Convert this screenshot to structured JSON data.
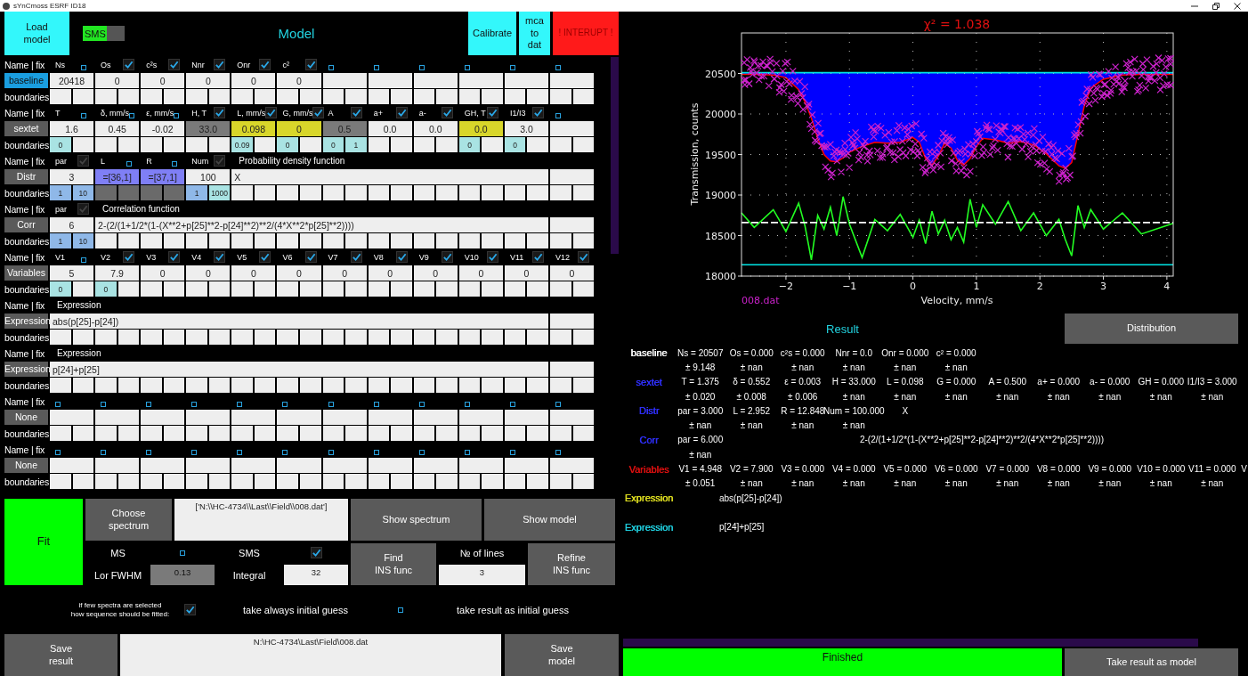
{
  "window": {
    "title": "sYnCmoss ESRF ID18"
  },
  "model": {
    "load_button": "Load\nmodel",
    "sms_toggle": {
      "label": "SMS",
      "on": true
    },
    "title": "Model",
    "calibrate_button": "Calibrate",
    "mca_button": "mca\nto\ndat",
    "interrupt_button": "! INTERUPT !",
    "blocks": [
      {
        "name": "baseline",
        "selected": true,
        "header_label": "Name | fix",
        "bounds_label": "boundaries",
        "header": [
          {
            "kind": "check",
            "label": "Ns",
            "fixed": false
          },
          {
            "kind": "check",
            "label": "Os",
            "fixed": true
          },
          {
            "kind": "check",
            "label": "c²s",
            "fixed": true
          },
          {
            "kind": "check",
            "label": "Nnr",
            "fixed": true
          },
          {
            "kind": "check",
            "label": "Onr",
            "fixed": true
          },
          {
            "kind": "check",
            "label": "c²",
            "fixed": true
          },
          {
            "kind": "check",
            "fixed": false
          },
          {
            "kind": "check",
            "fixed": false
          },
          {
            "kind": "check",
            "fixed": false
          },
          {
            "kind": "check",
            "fixed": false
          },
          {
            "kind": "check",
            "fixed": false
          },
          {
            "kind": "check",
            "fixed": false
          }
        ],
        "cells": [
          {
            "kind": "value",
            "text": "20418"
          },
          {
            "kind": "value",
            "text": "0"
          },
          {
            "kind": "value",
            "text": "0"
          },
          {
            "kind": "value",
            "text": "0"
          },
          {
            "kind": "value",
            "text": "0"
          },
          {
            "kind": "value",
            "text": "0"
          },
          {
            "kind": "blank"
          },
          {
            "kind": "blank"
          },
          {
            "kind": "blank"
          },
          {
            "kind": "blank"
          },
          {
            "kind": "blank"
          },
          {
            "kind": "blank"
          }
        ],
        "bounds": [
          {
            "kind": "blank"
          },
          {
            "kind": "blank"
          },
          {
            "kind": "blank"
          },
          {
            "kind": "blank"
          },
          {
            "kind": "blank"
          },
          {
            "kind": "blank"
          },
          {
            "kind": "blank"
          },
          {
            "kind": "blank"
          },
          {
            "kind": "blank"
          },
          {
            "kind": "blank"
          },
          {
            "kind": "blank"
          },
          {
            "kind": "blank"
          },
          {
            "kind": "blank"
          },
          {
            "kind": "blank"
          },
          {
            "kind": "blank"
          },
          {
            "kind": "blank"
          },
          {
            "kind": "blank"
          },
          {
            "kind": "blank"
          },
          {
            "kind": "blank"
          },
          {
            "kind": "blank"
          },
          {
            "kind": "blank"
          },
          {
            "kind": "blank"
          },
          {
            "kind": "blank"
          },
          {
            "kind": "blank"
          }
        ]
      },
      {
        "name": "sextet",
        "selected": false,
        "header_label": "Name | fix",
        "bounds_label": "boundaries",
        "header": [
          {
            "kind": "check",
            "label": "T",
            "fixed": false
          },
          {
            "kind": "check",
            "label": "δ, mm/s",
            "fixed": false
          },
          {
            "kind": "check",
            "label": "ε, mm/s",
            "fixed": false
          },
          {
            "kind": "check",
            "label": "H, T",
            "fixed": true
          },
          {
            "kind": "check",
            "label": "L, mm/s",
            "fixed": true
          },
          {
            "kind": "check",
            "label": "G, mm/s",
            "fixed": true
          },
          {
            "kind": "check",
            "label": "A",
            "fixed": true
          },
          {
            "kind": "check",
            "label": "a+",
            "fixed": true
          },
          {
            "kind": "check",
            "label": "a-",
            "fixed": true
          },
          {
            "kind": "check",
            "label": "GH, T",
            "fixed": true
          },
          {
            "kind": "check",
            "label": "I1/I3",
            "fixed": true
          },
          {
            "kind": "check",
            "fixed": false
          }
        ],
        "cells": [
          {
            "kind": "value",
            "text": "1.6"
          },
          {
            "kind": "value",
            "text": "0.45"
          },
          {
            "kind": "value",
            "text": "-0.02"
          },
          {
            "kind": "value",
            "text": "33.0",
            "color": "#7a7a7a"
          },
          {
            "kind": "value",
            "text": "0.098",
            "color": "#d8d62a"
          },
          {
            "kind": "value",
            "text": "0",
            "color": "#d8d62a"
          },
          {
            "kind": "value",
            "text": "0.5",
            "color": "#7a7a7a"
          },
          {
            "kind": "value",
            "text": "0.0"
          },
          {
            "kind": "value",
            "text": "0.0"
          },
          {
            "kind": "value",
            "text": "0.0",
            "color": "#d8d62a"
          },
          {
            "kind": "value",
            "text": "3.0"
          },
          {
            "kind": "blank"
          }
        ],
        "bounds": [
          {
            "kind": "value",
            "text": "0",
            "color": "#a9e3e3"
          },
          {
            "kind": "blank"
          },
          {
            "kind": "blank"
          },
          {
            "kind": "blank"
          },
          {
            "kind": "blank"
          },
          {
            "kind": "blank"
          },
          {
            "kind": "blank"
          },
          {
            "kind": "blank"
          },
          {
            "kind": "value",
            "text": "0.09",
            "color": "#a9e3e3"
          },
          {
            "kind": "blank"
          },
          {
            "kind": "value",
            "text": "0",
            "color": "#a9e3e3"
          },
          {
            "kind": "blank"
          },
          {
            "kind": "value",
            "text": "0",
            "color": "#a9e3e3"
          },
          {
            "kind": "value",
            "text": "1",
            "color": "#a9e3e3"
          },
          {
            "kind": "blank"
          },
          {
            "kind": "blank"
          },
          {
            "kind": "blank"
          },
          {
            "kind": "blank"
          },
          {
            "kind": "value",
            "text": "0",
            "color": "#a9e3e3"
          },
          {
            "kind": "blank"
          },
          {
            "kind": "value",
            "text": "0",
            "color": "#a9e3e3"
          },
          {
            "kind": "blank"
          },
          {
            "kind": "blank"
          },
          {
            "kind": "blank"
          }
        ]
      },
      {
        "name": "Distr",
        "selected": false,
        "header_label": "Name | fix",
        "bounds_label": "boundaries",
        "header": [
          {
            "kind": "check",
            "label": "par",
            "fixed": true,
            "disabled": true
          },
          {
            "kind": "check",
            "label": "L",
            "fixed": false,
            "disabled": false
          },
          {
            "kind": "check",
            "label": "R",
            "fixed": false,
            "disabled": false
          },
          {
            "kind": "check",
            "label": "Num",
            "fixed": true,
            "disabled": true
          },
          {
            "kind": "caption",
            "label": "Probability density function"
          }
        ],
        "cells": [
          {
            "kind": "value",
            "text": "3"
          },
          {
            "kind": "value",
            "text": "=[36,1]",
            "color": "#7f7ff5"
          },
          {
            "kind": "value",
            "text": "=[37,1]",
            "color": "#7f7ff5"
          },
          {
            "kind": "value",
            "text": "100"
          },
          {
            "kind": "formula",
            "text": "X"
          },
          {
            "kind": "blank"
          }
        ],
        "bounds": [
          {
            "kind": "value",
            "text": "1",
            "color": "#8fb8e8"
          },
          {
            "kind": "value",
            "text": "10",
            "color": "#8fb8e8"
          },
          {
            "kind": "blank",
            "color": "#6a6a6a"
          },
          {
            "kind": "blank",
            "color": "#6a6a6a"
          },
          {
            "kind": "blank",
            "color": "#6a6a6a"
          },
          {
            "kind": "blank",
            "color": "#6a6a6a"
          },
          {
            "kind": "value",
            "text": "1",
            "color": "#8fb8e8"
          },
          {
            "kind": "value",
            "text": "1000",
            "color": "#a9e3e3"
          },
          {
            "kind": "blank"
          },
          {
            "kind": "blank"
          },
          {
            "kind": "blank"
          },
          {
            "kind": "blank"
          },
          {
            "kind": "blank"
          },
          {
            "kind": "blank"
          },
          {
            "kind": "blank"
          },
          {
            "kind": "blank"
          },
          {
            "kind": "blank"
          },
          {
            "kind": "blank"
          },
          {
            "kind": "blank"
          },
          {
            "kind": "blank"
          },
          {
            "kind": "blank"
          },
          {
            "kind": "blank"
          },
          {
            "kind": "blank"
          },
          {
            "kind": "blank"
          }
        ]
      },
      {
        "name": "Corr",
        "selected": false,
        "header_label": "Name | fix",
        "bounds_label": "boundaries",
        "header": [
          {
            "kind": "check",
            "label": "par",
            "fixed": true,
            "disabled": true
          },
          {
            "kind": "caption",
            "label": "Correlation function"
          }
        ],
        "cells": [
          {
            "kind": "value",
            "text": "6"
          },
          {
            "kind": "formula",
            "text": "2-(2/(1+1/2*(1-(X**2+p[25]**2-p[24]**2)**2/(4*X**2*p[25]**2))))"
          },
          {
            "kind": "blank"
          }
        ],
        "bounds": [
          {
            "kind": "value",
            "text": "1",
            "color": "#8fb8e8"
          },
          {
            "kind": "value",
            "text": "10",
            "color": "#8fb8e8"
          },
          {
            "kind": "blank"
          },
          {
            "kind": "blank"
          },
          {
            "kind": "blank"
          },
          {
            "kind": "blank"
          },
          {
            "kind": "blank"
          },
          {
            "kind": "blank"
          },
          {
            "kind": "blank"
          },
          {
            "kind": "blank"
          },
          {
            "kind": "blank"
          },
          {
            "kind": "blank"
          },
          {
            "kind": "blank"
          },
          {
            "kind": "blank"
          },
          {
            "kind": "blank"
          },
          {
            "kind": "blank"
          },
          {
            "kind": "blank"
          },
          {
            "kind": "blank"
          },
          {
            "kind": "blank"
          },
          {
            "kind": "blank"
          },
          {
            "kind": "blank"
          },
          {
            "kind": "blank"
          },
          {
            "kind": "blank"
          },
          {
            "kind": "blank"
          }
        ]
      },
      {
        "name": "Variables",
        "selected": false,
        "header_label": "Name | fix",
        "bounds_label": "boundaries",
        "header": [
          {
            "kind": "check",
            "label": "V1",
            "fixed": false
          },
          {
            "kind": "check",
            "label": "V2",
            "fixed": true
          },
          {
            "kind": "check",
            "label": "V3",
            "fixed": true
          },
          {
            "kind": "check",
            "label": "V4",
            "fixed": true
          },
          {
            "kind": "check",
            "label": "V5",
            "fixed": true
          },
          {
            "kind": "check",
            "label": "V6",
            "fixed": true
          },
          {
            "kind": "check",
            "label": "V7",
            "fixed": true
          },
          {
            "kind": "check",
            "label": "V8",
            "fixed": true
          },
          {
            "kind": "check",
            "label": "V9",
            "fixed": true
          },
          {
            "kind": "check",
            "label": "V10",
            "fixed": true
          },
          {
            "kind": "check",
            "label": "V11",
            "fixed": true
          },
          {
            "kind": "check",
            "label": "V12",
            "fixed": true
          }
        ],
        "cells": [
          {
            "kind": "value",
            "text": "5"
          },
          {
            "kind": "value",
            "text": "7.9"
          },
          {
            "kind": "value",
            "text": "0"
          },
          {
            "kind": "value",
            "text": "0"
          },
          {
            "kind": "value",
            "text": "0"
          },
          {
            "kind": "value",
            "text": "0"
          },
          {
            "kind": "value",
            "text": "0"
          },
          {
            "kind": "value",
            "text": "0"
          },
          {
            "kind": "value",
            "text": "0"
          },
          {
            "kind": "value",
            "text": "0"
          },
          {
            "kind": "value",
            "text": "0"
          },
          {
            "kind": "value",
            "text": "0"
          }
        ],
        "bounds": [
          {
            "kind": "value",
            "text": "0",
            "color": "#a9e3e3"
          },
          {
            "kind": "blank"
          },
          {
            "kind": "value",
            "text": "0",
            "color": "#a9e3e3"
          },
          {
            "kind": "blank"
          },
          {
            "kind": "blank"
          },
          {
            "kind": "blank"
          },
          {
            "kind": "blank"
          },
          {
            "kind": "blank"
          },
          {
            "kind": "blank"
          },
          {
            "kind": "blank"
          },
          {
            "kind": "blank"
          },
          {
            "kind": "blank"
          },
          {
            "kind": "blank"
          },
          {
            "kind": "blank"
          },
          {
            "kind": "blank"
          },
          {
            "kind": "blank"
          },
          {
            "kind": "blank"
          },
          {
            "kind": "blank"
          },
          {
            "kind": "blank"
          },
          {
            "kind": "blank"
          },
          {
            "kind": "blank"
          },
          {
            "kind": "blank"
          },
          {
            "kind": "blank"
          },
          {
            "kind": "blank"
          }
        ]
      },
      {
        "name": "Expression",
        "selected": false,
        "header_label": "Name | fix",
        "bounds_label": "boundaries",
        "header": [
          {
            "kind": "caption",
            "label": "Expression"
          }
        ],
        "cells": [
          {
            "kind": "formula",
            "text": "abs(p[25]-p[24])"
          },
          {
            "kind": "blank"
          }
        ],
        "bounds": [
          {
            "kind": "blank"
          },
          {
            "kind": "blank"
          },
          {
            "kind": "blank"
          },
          {
            "kind": "blank"
          },
          {
            "kind": "blank"
          },
          {
            "kind": "blank"
          },
          {
            "kind": "blank"
          },
          {
            "kind": "blank"
          },
          {
            "kind": "blank"
          },
          {
            "kind": "blank"
          },
          {
            "kind": "blank"
          },
          {
            "kind": "blank"
          },
          {
            "kind": "blank"
          },
          {
            "kind": "blank"
          },
          {
            "kind": "blank"
          },
          {
            "kind": "blank"
          },
          {
            "kind": "blank"
          },
          {
            "kind": "blank"
          },
          {
            "kind": "blank"
          },
          {
            "kind": "blank"
          },
          {
            "kind": "blank"
          },
          {
            "kind": "blank"
          },
          {
            "kind": "blank"
          },
          {
            "kind": "blank"
          }
        ]
      },
      {
        "name": "Expression",
        "selected": false,
        "header_label": "Name | fix",
        "bounds_label": "boundaries",
        "header": [
          {
            "kind": "caption",
            "label": "Expression"
          }
        ],
        "cells": [
          {
            "kind": "formula",
            "text": "p[24]+p[25]"
          },
          {
            "kind": "blank"
          }
        ],
        "bounds": [
          {
            "kind": "blank"
          },
          {
            "kind": "blank"
          },
          {
            "kind": "blank"
          },
          {
            "kind": "blank"
          },
          {
            "kind": "blank"
          },
          {
            "kind": "blank"
          },
          {
            "kind": "blank"
          },
          {
            "kind": "blank"
          },
          {
            "kind": "blank"
          },
          {
            "kind": "blank"
          },
          {
            "kind": "blank"
          },
          {
            "kind": "blank"
          },
          {
            "kind": "blank"
          },
          {
            "kind": "blank"
          },
          {
            "kind": "blank"
          },
          {
            "kind": "blank"
          },
          {
            "kind": "blank"
          },
          {
            "kind": "blank"
          },
          {
            "kind": "blank"
          },
          {
            "kind": "blank"
          },
          {
            "kind": "blank"
          },
          {
            "kind": "blank"
          },
          {
            "kind": "blank"
          },
          {
            "kind": "blank"
          }
        ]
      },
      {
        "name": "None",
        "selected": false,
        "header_label": "Name | fix",
        "bounds_label": "boundaries",
        "header": [
          {
            "kind": "check",
            "fixed": false
          },
          {
            "kind": "check",
            "fixed": false
          },
          {
            "kind": "check",
            "fixed": false
          },
          {
            "kind": "check",
            "fixed": false
          },
          {
            "kind": "check",
            "fixed": false
          },
          {
            "kind": "check",
            "fixed": false
          },
          {
            "kind": "check",
            "fixed": false
          },
          {
            "kind": "check",
            "fixed": false
          },
          {
            "kind": "check",
            "fixed": false
          },
          {
            "kind": "check",
            "fixed": false
          },
          {
            "kind": "check",
            "fixed": false
          },
          {
            "kind": "check",
            "fixed": false
          }
        ],
        "cells": [
          {
            "kind": "blank"
          },
          {
            "kind": "blank"
          },
          {
            "kind": "blank"
          },
          {
            "kind": "blank"
          },
          {
            "kind": "blank"
          },
          {
            "kind": "blank"
          },
          {
            "kind": "blank"
          },
          {
            "kind": "blank"
          },
          {
            "kind": "blank"
          },
          {
            "kind": "blank"
          },
          {
            "kind": "blank"
          },
          {
            "kind": "blank"
          }
        ],
        "bounds": [
          {
            "kind": "blank"
          },
          {
            "kind": "blank"
          },
          {
            "kind": "blank"
          },
          {
            "kind": "blank"
          },
          {
            "kind": "blank"
          },
          {
            "kind": "blank"
          },
          {
            "kind": "blank"
          },
          {
            "kind": "blank"
          },
          {
            "kind": "blank"
          },
          {
            "kind": "blank"
          },
          {
            "kind": "blank"
          },
          {
            "kind": "blank"
          },
          {
            "kind": "blank"
          },
          {
            "kind": "blank"
          },
          {
            "kind": "blank"
          },
          {
            "kind": "blank"
          },
          {
            "kind": "blank"
          },
          {
            "kind": "blank"
          },
          {
            "kind": "blank"
          },
          {
            "kind": "blank"
          },
          {
            "kind": "blank"
          },
          {
            "kind": "blank"
          },
          {
            "kind": "blank"
          },
          {
            "kind": "blank"
          }
        ]
      },
      {
        "name": "None",
        "selected": false,
        "header_label": "Name | fix",
        "bounds_label": "boundaries",
        "header": [
          {
            "kind": "check",
            "fixed": false
          },
          {
            "kind": "check",
            "fixed": false
          },
          {
            "kind": "check",
            "fixed": false
          },
          {
            "kind": "check",
            "fixed": false
          },
          {
            "kind": "check",
            "fixed": false
          },
          {
            "kind": "check",
            "fixed": false
          },
          {
            "kind": "check",
            "fixed": false
          },
          {
            "kind": "check",
            "fixed": false
          },
          {
            "kind": "check",
            "fixed": false
          },
          {
            "kind": "check",
            "fixed": false
          },
          {
            "kind": "check",
            "fixed": false
          },
          {
            "kind": "check",
            "fixed": false
          }
        ],
        "cells": [
          {
            "kind": "blank"
          },
          {
            "kind": "blank"
          },
          {
            "kind": "blank"
          },
          {
            "kind": "blank"
          },
          {
            "kind": "blank"
          },
          {
            "kind": "blank"
          },
          {
            "kind": "blank"
          },
          {
            "kind": "blank"
          },
          {
            "kind": "blank"
          },
          {
            "kind": "blank"
          },
          {
            "kind": "blank"
          },
          {
            "kind": "blank"
          }
        ],
        "bounds": [
          {
            "kind": "blank"
          },
          {
            "kind": "blank"
          },
          {
            "kind": "blank"
          },
          {
            "kind": "blank"
          },
          {
            "kind": "blank"
          },
          {
            "kind": "blank"
          },
          {
            "kind": "blank"
          },
          {
            "kind": "blank"
          },
          {
            "kind": "blank"
          },
          {
            "kind": "blank"
          },
          {
            "kind": "blank"
          },
          {
            "kind": "blank"
          },
          {
            "kind": "blank"
          },
          {
            "kind": "blank"
          },
          {
            "kind": "blank"
          },
          {
            "kind": "blank"
          },
          {
            "kind": "blank"
          },
          {
            "kind": "blank"
          },
          {
            "kind": "blank"
          },
          {
            "kind": "blank"
          },
          {
            "kind": "blank"
          },
          {
            "kind": "blank"
          },
          {
            "kind": "blank"
          },
          {
            "kind": "blank"
          }
        ]
      }
    ]
  },
  "fit_panel": {
    "fit_button": "Fit",
    "choose_button": "Choose\nspectrum",
    "files_field": "['N:\\\\HC-4734\\\\Last\\\\Field\\\\008.dat']",
    "show_spectrum_button": "Show spectrum",
    "show_model_button": "Show model",
    "ms": {
      "label": "MS",
      "checked": false
    },
    "sms": {
      "label": "SMS",
      "checked": true
    },
    "lor_fwhm": {
      "label": "Lor FWHM",
      "value": "0.13"
    },
    "integral": {
      "label": "Integral",
      "value": "32"
    },
    "find_button": "Find\nINS func",
    "lines": {
      "label": "№ of lines",
      "value": "3"
    },
    "refine_button": "Refine\nINS func",
    "sequence_note": "if few spectra are selected\nhow sequence should be fitted:",
    "sequence_options": [
      {
        "label": "take always initial guess",
        "checked": true
      },
      {
        "label": "take result as initial guess",
        "checked": false
      }
    ],
    "save_result_button": "Save\nresult",
    "path_field": "N:\\HC-4734\\Last\\Field\\008.dat",
    "save_model_button": "Save\nmodel"
  },
  "spectrum_panel": {
    "spectrum_label": "008.dat",
    "chart_data": {
      "type": "line",
      "title": "χ² = 1.038",
      "xlabel": "Velocity, mm/s",
      "ylabel": "Transmission, counts",
      "grid": true,
      "x": [
        -2.7,
        -2.5,
        -2.2,
        -2.0,
        -1.8,
        -1.7,
        -1.6,
        -1.5,
        -1.4,
        -1.3,
        -1.2,
        -1.1,
        -1.0,
        -0.8,
        -0.6,
        -0.4,
        -0.2,
        0.0,
        0.1,
        0.2,
        0.3,
        0.4,
        0.5,
        0.6,
        0.7,
        0.8,
        0.9,
        1.0,
        1.1,
        1.3,
        1.5,
        1.7,
        1.9,
        2.1,
        2.3,
        2.4,
        2.5,
        2.6,
        2.7,
        2.8,
        3.0,
        3.3,
        3.6,
        4.1
      ],
      "series": [
        {
          "color": "#ff0000",
          "values": [
            20490,
            20490,
            20480,
            20450,
            20300,
            20150,
            19950,
            19700,
            19500,
            19420,
            19410,
            19460,
            19530,
            19600,
            19650,
            19640,
            19650,
            19710,
            19650,
            19450,
            19370,
            19480,
            19640,
            19580,
            19430,
            19370,
            19450,
            19600,
            19700,
            19680,
            19640,
            19660,
            19620,
            19510,
            19360,
            19330,
            19400,
            19750,
            20100,
            20320,
            20430,
            20480,
            20490,
            20490
          ]
        },
        {
          "color": "#00e5e5",
          "values": [
            20510,
            20510,
            20510,
            20510,
            20510,
            20510,
            20510,
            20510,
            20510,
            20510,
            20510,
            20510,
            20510,
            20510,
            20510,
            20510,
            20510,
            20510,
            20510,
            20510,
            20510,
            20510,
            20510,
            20510,
            20510,
            20510,
            20510,
            20510,
            20510,
            20510,
            20510,
            20510,
            20510,
            20510,
            20510,
            20510,
            20510,
            20510,
            20510,
            20510,
            20510,
            20510,
            20510,
            20510
          ]
        },
        {
          "color": "#22ff22",
          "values": [
            18780,
            18600,
            18820,
            18550,
            18900,
            18620,
            18200,
            18750,
            18580,
            18850,
            18500,
            18980,
            18640,
            18230,
            18700,
            18560,
            18760,
            18480,
            18690,
            18400,
            18800,
            18520,
            18690,
            18450,
            18600,
            18420,
            18950,
            18600,
            18880,
            18640,
            18920,
            18560,
            18780,
            18500,
            18700,
            18450,
            18250,
            18870,
            18600,
            18820,
            18580,
            18780,
            18520,
            18650
          ]
        },
        {
          "color": "#ffffff",
          "line_style": "dashed",
          "values": [
            18660,
            18660,
            18660,
            18660,
            18660,
            18660,
            18660,
            18660,
            18660,
            18660,
            18660,
            18660,
            18660,
            18660,
            18660,
            18660,
            18660,
            18660,
            18660,
            18660,
            18660,
            18660,
            18660,
            18660,
            18660,
            18660,
            18660,
            18660,
            18660,
            18660,
            18660,
            18660,
            18660,
            18660,
            18660,
            18660,
            18660,
            18660,
            18660,
            18660,
            18660,
            18660,
            18660,
            18660
          ]
        },
        {
          "color": "#00e5e5",
          "values": [
            18140,
            18140,
            18140,
            18140,
            18140,
            18140,
            18140,
            18140,
            18140,
            18140,
            18140,
            18140,
            18140,
            18140,
            18140,
            18140,
            18140,
            18140,
            18140,
            18140,
            18140,
            18140,
            18140,
            18140,
            18140,
            18140,
            18140,
            18140,
            18140,
            18140,
            18140,
            18140,
            18140,
            18140,
            18140,
            18140,
            18140,
            18140,
            18140,
            18140,
            18140,
            18140,
            18140,
            18140
          ]
        }
      ],
      "xlim": [
        -2.7,
        4.1
      ],
      "ylim": [
        18000,
        21000
      ],
      "xticks": [
        {
          "value": -2,
          "label": "−2"
        },
        {
          "value": -1,
          "label": "−1"
        },
        0,
        1,
        2,
        3,
        4
      ],
      "yticks": [
        18000,
        18500,
        19000,
        19500,
        20000,
        20500
      ]
    }
  },
  "results": {
    "title": "Result",
    "distribution_button": "Distribution",
    "groups": [
      {
        "kind": "parameters",
        "name": "baseline",
        "color": "#ffffff",
        "items": [
          {
            "value": "Ns = 20507",
            "error": "± 9.148"
          },
          {
            "value": "Os = 0.000",
            "error": "± nan"
          },
          {
            "value": "c²s = 0.000",
            "error": "± nan"
          },
          {
            "value": "Nnr = 0.0",
            "error": "± nan"
          },
          {
            "value": "Onr = 0.000",
            "error": "± nan"
          },
          {
            "value": "c² = 0.000",
            "error": "± nan"
          }
        ]
      },
      {
        "kind": "parameters",
        "name": "sextet",
        "color": "#3030ff",
        "items": [
          {
            "value": "T = 1.375",
            "error": "± 0.020"
          },
          {
            "value": "δ = 0.552",
            "error": "± 0.008"
          },
          {
            "value": "ε = 0.003",
            "error": "± 0.006"
          },
          {
            "value": "H = 33.000",
            "error": "± nan"
          },
          {
            "value": "L = 0.098",
            "error": "± nan"
          },
          {
            "value": "G = 0.000",
            "error": "± nan"
          },
          {
            "value": "A = 0.500",
            "error": "± nan"
          },
          {
            "value": "a+ = 0.000",
            "error": "± nan"
          },
          {
            "value": "a- = 0.000",
            "error": "± nan"
          },
          {
            "value": "GH = 0.000",
            "error": "± nan"
          },
          {
            "value": "I1/I3 = 3.000",
            "error": "± nan"
          }
        ]
      },
      {
        "kind": "parameters",
        "name": "Distr",
        "color": "#3030ff",
        "items": [
          {
            "value": "par = 3.000",
            "error": "± nan"
          },
          {
            "value": "L = 2.952",
            "error": "± nan"
          },
          {
            "value": "R = 12.848",
            "error": "± nan"
          },
          {
            "value": "Num = 100.000",
            "error": "± nan"
          },
          {
            "value": "X"
          }
        ]
      },
      {
        "kind": "parameters",
        "name": "Corr",
        "color": "#3030ff",
        "items": [
          {
            "value": "par = 6.000",
            "error": "± nan"
          },
          {
            "kind": "formula",
            "value": "2-(2/(1+1/2*(1-(X**2+p[25]**2-p[24]**2)**2/(4*X**2*p[25]**2))))"
          }
        ]
      },
      {
        "kind": "parameters",
        "name": "Variables",
        "color": "#e01010",
        "items": [
          {
            "value": "V1 = 4.948",
            "error": "± 0.051"
          },
          {
            "value": "V2 = 7.900",
            "error": "± nan"
          },
          {
            "value": "V3 = 0.000",
            "error": "± nan"
          },
          {
            "value": "V4 = 0.000",
            "error": "± nan"
          },
          {
            "value": "V5 = 0.000",
            "error": "± nan"
          },
          {
            "value": "V6 = 0.000",
            "error": "± nan"
          },
          {
            "value": "V7 = 0.000",
            "error": "± nan"
          },
          {
            "value": "V8 = 0.000",
            "error": "± nan"
          },
          {
            "value": "V9 = 0.000",
            "error": "± nan"
          },
          {
            "value": "V10 = 0.000",
            "error": "± nan"
          },
          {
            "value": "V11 = 0.000",
            "error": "± nan"
          },
          {
            "value": "V"
          }
        ]
      },
      {
        "kind": "expression",
        "name": "Expression",
        "color": "#e0e020",
        "items": [
          {
            "value": "abs(p[25]-p[24])"
          }
        ]
      },
      {
        "kind": "expression",
        "name": "Expression",
        "color": "#20d0e0",
        "items": [
          {
            "value": "p[24]+p[25]"
          }
        ]
      }
    ]
  },
  "status": "Finished",
  "take_result_button": "Take result as model"
}
